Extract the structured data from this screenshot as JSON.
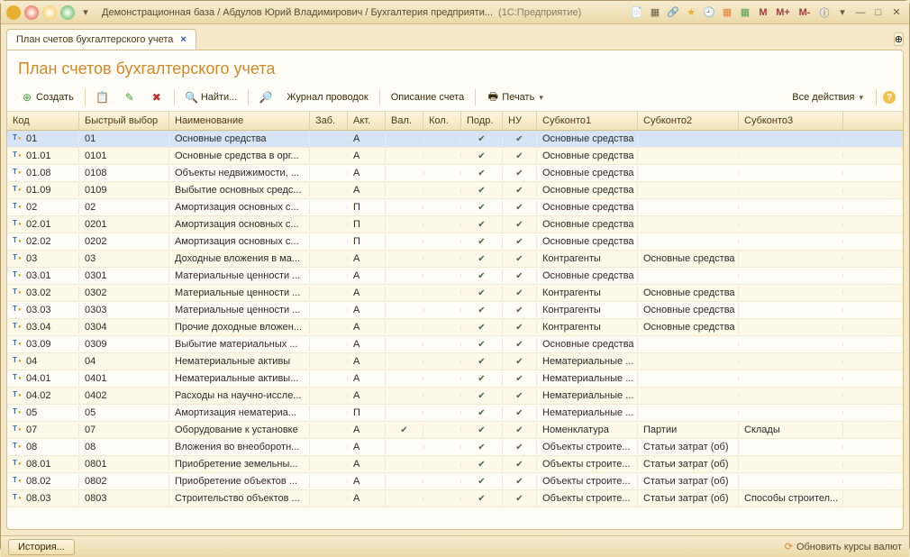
{
  "titlebar": {
    "title": "Демонстрационная база / Абдулов Юрий Владимирович / Бухгалтерия предприяти...",
    "suffix": "(1С:Предприятие)",
    "m_labels": [
      "M",
      "M+",
      "M-"
    ]
  },
  "tab": {
    "label": "План счетов бухгалтерского учета"
  },
  "heading": "План счетов бухгалтерского учета",
  "toolbar": {
    "create": "Создать",
    "find": "Найти...",
    "journal": "Журнал проводок",
    "desc": "Описание счета",
    "print": "Печать",
    "all_actions": "Все действия"
  },
  "columns": [
    "Код",
    "Быстрый выбор",
    "Наименование",
    "Заб.",
    "Акт.",
    "Вал.",
    "Кол.",
    "Подр.",
    "НУ",
    "Субконто1",
    "Субконто2",
    "Субконто3"
  ],
  "rows": [
    {
      "code": "01",
      "quick": "01",
      "name": "Основные средства",
      "act": "А",
      "podr": true,
      "nu": true,
      "s1": "Основные средства",
      "s2": "",
      "s3": "",
      "sel": true
    },
    {
      "code": "01.01",
      "quick": "0101",
      "name": "Основные средства в орг...",
      "act": "А",
      "podr": true,
      "nu": true,
      "s1": "Основные средства",
      "s2": "",
      "s3": ""
    },
    {
      "code": "01.08",
      "quick": "0108",
      "name": "Объекты недвижимости, ...",
      "act": "А",
      "podr": true,
      "nu": true,
      "s1": "Основные средства",
      "s2": "",
      "s3": ""
    },
    {
      "code": "01.09",
      "quick": "0109",
      "name": "Выбытие основных средс...",
      "act": "А",
      "podr": true,
      "nu": true,
      "s1": "Основные средства",
      "s2": "",
      "s3": ""
    },
    {
      "code": "02",
      "quick": "02",
      "name": "Амортизация основных с...",
      "act": "П",
      "podr": true,
      "nu": true,
      "s1": "Основные средства",
      "s2": "",
      "s3": ""
    },
    {
      "code": "02.01",
      "quick": "0201",
      "name": "Амортизация основных с...",
      "act": "П",
      "podr": true,
      "nu": true,
      "s1": "Основные средства",
      "s2": "",
      "s3": ""
    },
    {
      "code": "02.02",
      "quick": "0202",
      "name": "Амортизация основных с...",
      "act": "П",
      "podr": true,
      "nu": true,
      "s1": "Основные средства",
      "s2": "",
      "s3": ""
    },
    {
      "code": "03",
      "quick": "03",
      "name": "Доходные вложения в ма...",
      "act": "А",
      "podr": true,
      "nu": true,
      "s1": "Контрагенты",
      "s2": "Основные средства",
      "s3": ""
    },
    {
      "code": "03.01",
      "quick": "0301",
      "name": "Материальные ценности ...",
      "act": "А",
      "podr": true,
      "nu": true,
      "s1": "Основные средства",
      "s2": "",
      "s3": ""
    },
    {
      "code": "03.02",
      "quick": "0302",
      "name": "Материальные ценности ...",
      "act": "А",
      "podr": true,
      "nu": true,
      "s1": "Контрагенты",
      "s2": "Основные средства",
      "s3": ""
    },
    {
      "code": "03.03",
      "quick": "0303",
      "name": "Материальные ценности ...",
      "act": "А",
      "podr": true,
      "nu": true,
      "s1": "Контрагенты",
      "s2": "Основные средства",
      "s3": ""
    },
    {
      "code": "03.04",
      "quick": "0304",
      "name": "Прочие доходные вложен...",
      "act": "А",
      "podr": true,
      "nu": true,
      "s1": "Контрагенты",
      "s2": "Основные средства",
      "s3": ""
    },
    {
      "code": "03.09",
      "quick": "0309",
      "name": "Выбытие материальных ...",
      "act": "А",
      "podr": true,
      "nu": true,
      "s1": "Основные средства",
      "s2": "",
      "s3": ""
    },
    {
      "code": "04",
      "quick": "04",
      "name": "Нематериальные активы",
      "act": "А",
      "podr": true,
      "nu": true,
      "s1": "Нематериальные ...",
      "s2": "",
      "s3": ""
    },
    {
      "code": "04.01",
      "quick": "0401",
      "name": "Нематериальные активы...",
      "act": "А",
      "podr": true,
      "nu": true,
      "s1": "Нематериальные ...",
      "s2": "",
      "s3": ""
    },
    {
      "code": "04.02",
      "quick": "0402",
      "name": "Расходы на научно-иссле...",
      "act": "А",
      "podr": true,
      "nu": true,
      "s1": "Нематериальные ...",
      "s2": "",
      "s3": ""
    },
    {
      "code": "05",
      "quick": "05",
      "name": "Амортизация нематериа...",
      "act": "П",
      "podr": true,
      "nu": true,
      "s1": "Нематериальные ...",
      "s2": "",
      "s3": ""
    },
    {
      "code": "07",
      "quick": "07",
      "name": "Оборудование к установке",
      "act": "А",
      "val": true,
      "podr": true,
      "nu": true,
      "s1": "Номенклатура",
      "s2": "Партии",
      "s3": "Склады"
    },
    {
      "code": "08",
      "quick": "08",
      "name": "Вложения во внеоборотн...",
      "act": "А",
      "podr": true,
      "nu": true,
      "s1": "Объекты строите...",
      "s2": "Статьи затрат (об)",
      "s3": ""
    },
    {
      "code": "08.01",
      "quick": "0801",
      "name": "Приобретение земельны...",
      "act": "А",
      "podr": true,
      "nu": true,
      "s1": "Объекты строите...",
      "s2": "Статьи затрат (об)",
      "s3": ""
    },
    {
      "code": "08.02",
      "quick": "0802",
      "name": "Приобретение объектов ...",
      "act": "А",
      "podr": true,
      "nu": true,
      "s1": "Объекты строите...",
      "s2": "Статьи затрат (об)",
      "s3": ""
    },
    {
      "code": "08.03",
      "quick": "0803",
      "name": "Строительство объектов ...",
      "act": "А",
      "podr": true,
      "nu": true,
      "s1": "Объекты строите...",
      "s2": "Статьи затрат (об)",
      "s3": "Способы строител..."
    }
  ],
  "statusbar": {
    "history": "История...",
    "refresh": "Обновить курсы валют"
  }
}
